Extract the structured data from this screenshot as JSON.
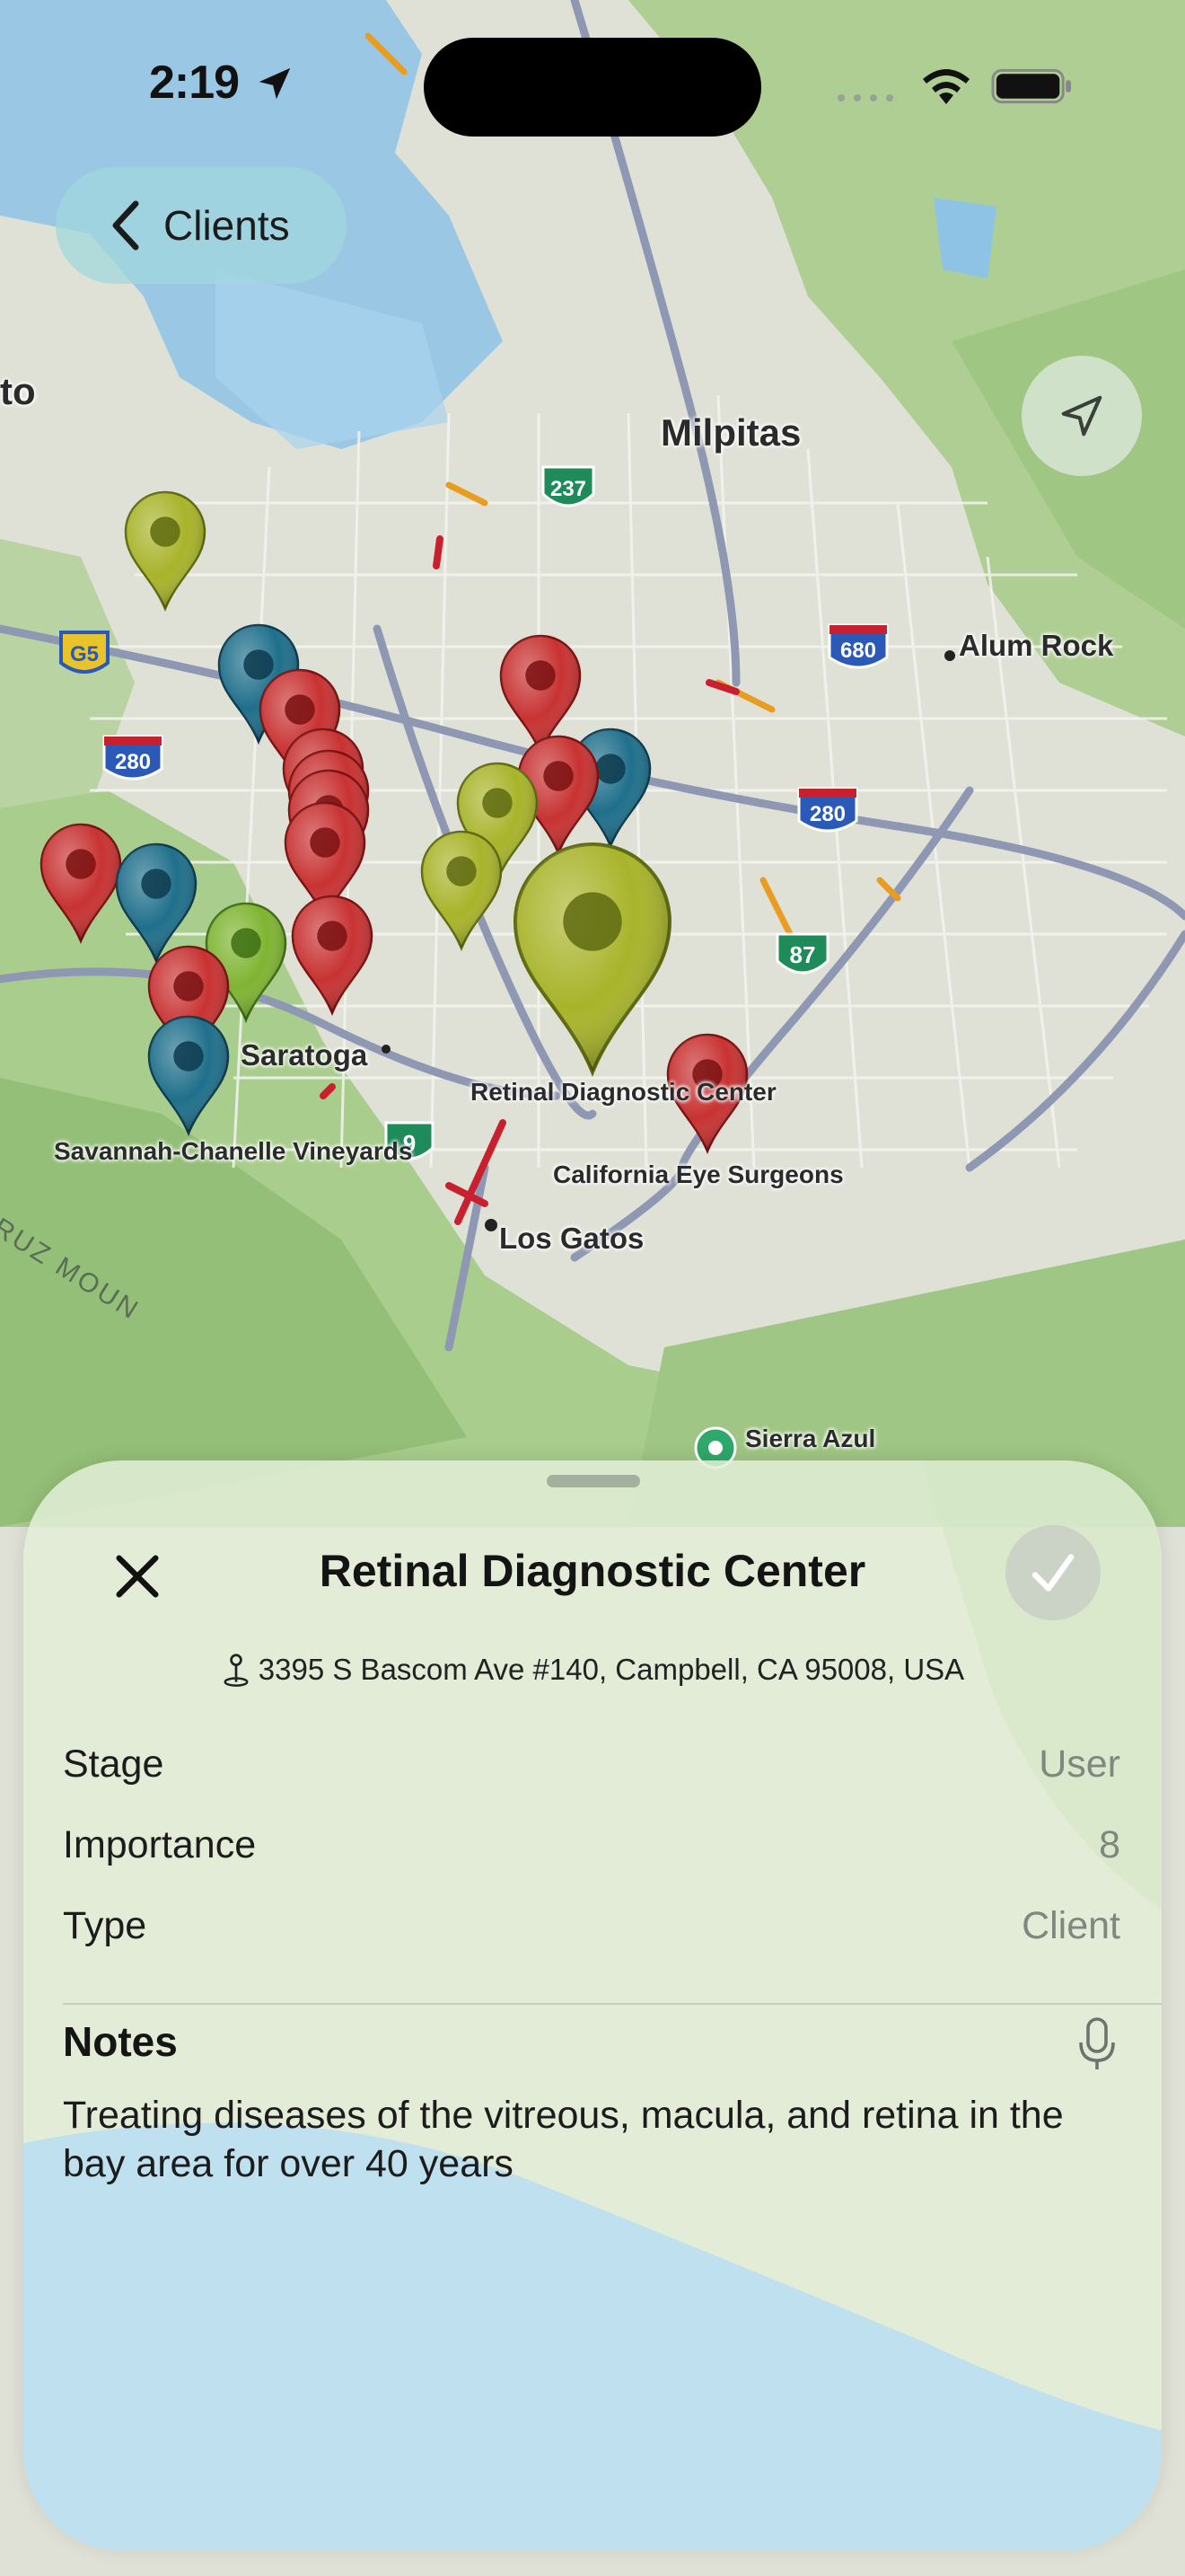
{
  "status_bar": {
    "time": "2:19",
    "location_icon": "location-arrow-icon",
    "wifi_icon": "wifi-icon",
    "battery_icon": "battery-icon"
  },
  "nav": {
    "back_label": "Clients",
    "back_icon": "chevron-left-icon",
    "locate_icon": "location-arrow-outline-icon"
  },
  "map": {
    "labels": [
      {
        "name": "city-label-milpitas",
        "text": "Milpitas"
      },
      {
        "name": "city-label-alum-rock",
        "text": "Alum Rock"
      },
      {
        "name": "city-label-saratoga",
        "text": "Saratoga"
      },
      {
        "name": "city-label-los-gatos",
        "text": "Los Gatos"
      },
      {
        "name": "poi-label-retinal",
        "text": "Retinal Diagnostic Center"
      },
      {
        "name": "poi-label-california-eye",
        "text": "California Eye Surgeons"
      },
      {
        "name": "poi-label-savannah",
        "text": "Savannah-Chanelle Vineyards"
      },
      {
        "name": "poi-label-sierra-azul",
        "text": "Sierra Azul"
      },
      {
        "name": "city-label-partial-left",
        "text": "to"
      }
    ],
    "shields": [
      {
        "type": "state",
        "number": "237"
      },
      {
        "type": "state",
        "number": "87"
      },
      {
        "type": "state",
        "number": "9"
      },
      {
        "type": "interstate",
        "number": "280"
      },
      {
        "type": "interstate",
        "number": "280"
      },
      {
        "type": "interstate",
        "number": "680"
      },
      {
        "type": "county",
        "number": "G5"
      }
    ],
    "mountain_label": "RUZ MOUN",
    "pin_colors": {
      "red": "#c83232",
      "teal": "#1f6f8b",
      "olive": "#a8b42a",
      "green": "#7fb432"
    }
  },
  "sheet": {
    "title": "Retinal Diagnostic Center",
    "address": "3395 S Bascom Ave #140, Campbell, CA 95008, USA",
    "address_icon": "map-pin-icon",
    "close_icon": "close-icon",
    "confirm_icon": "checkmark-icon",
    "fields": [
      {
        "label": "Stage",
        "value": "User"
      },
      {
        "label": "Importance",
        "value": "8"
      },
      {
        "label": "Type",
        "value": "Client"
      }
    ],
    "notes_heading": "Notes",
    "notes_icon": "microphone-icon",
    "notes": "Treating diseases of the vitreous, macula, and retina in the bay area for over 40 years"
  }
}
